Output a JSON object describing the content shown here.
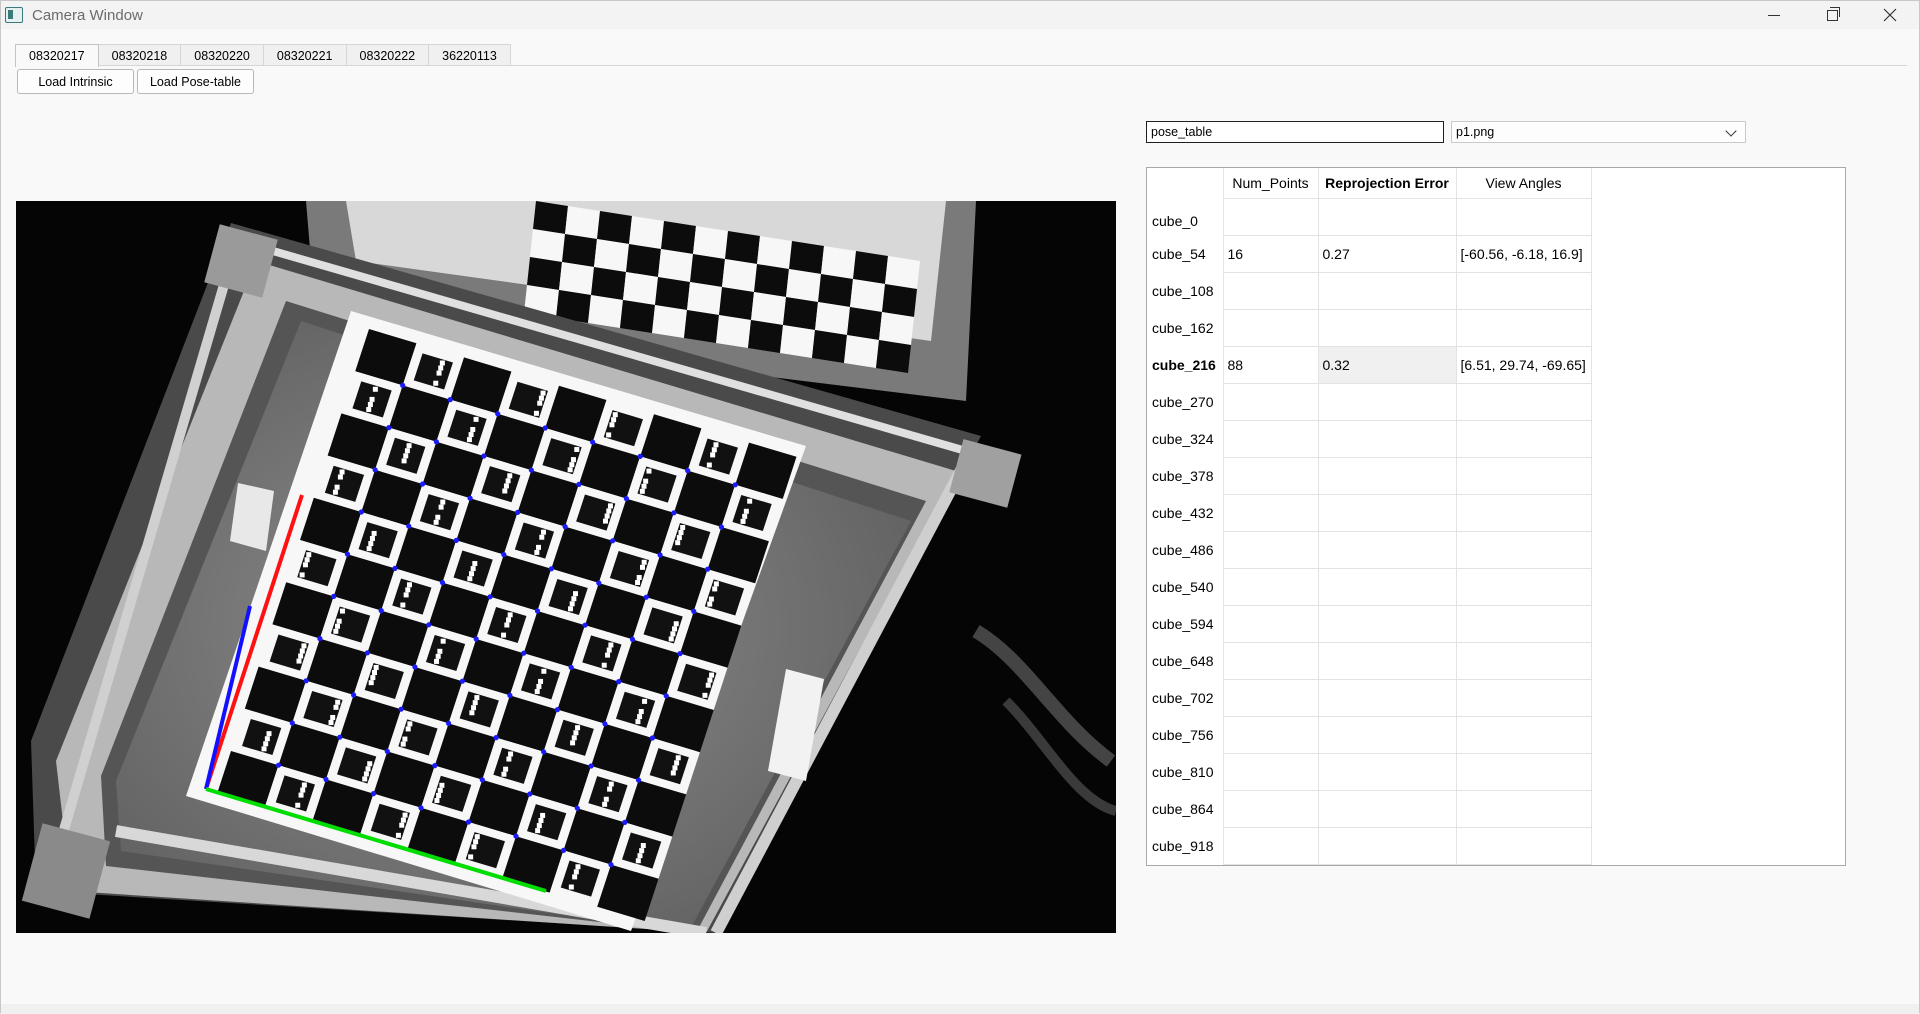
{
  "window": {
    "title": "Camera Window"
  },
  "tabs": [
    {
      "label": "08320217",
      "active": true
    },
    {
      "label": "08320218",
      "active": false
    },
    {
      "label": "08320220",
      "active": false
    },
    {
      "label": "08320221",
      "active": false
    },
    {
      "label": "08320222",
      "active": false
    },
    {
      "label": "36220113",
      "active": false
    }
  ],
  "toolbar": {
    "load_intrinsic": "Load Intrinsic",
    "load_pose_table": "Load Pose-table"
  },
  "controls": {
    "pose_input_value": "pose_table",
    "image_select_value": "p1.png"
  },
  "table": {
    "headers": [
      "Num_Points",
      "Reprojection Error",
      "View Angles"
    ],
    "rows": [
      {
        "label": "cube_0",
        "num_points": "",
        "error": "",
        "angles": ""
      },
      {
        "label": "cube_54",
        "num_points": "16",
        "error": "0.27",
        "angles": "[-60.56, -6.18, 16.9]"
      },
      {
        "label": "cube_108",
        "num_points": "",
        "error": "",
        "angles": ""
      },
      {
        "label": "cube_162",
        "num_points": "",
        "error": "",
        "angles": ""
      },
      {
        "label": "cube_216",
        "num_points": "88",
        "error": "0.32",
        "angles": "[6.51, 29.74, -69.65]",
        "selected": true
      },
      {
        "label": "cube_270",
        "num_points": "",
        "error": "",
        "angles": ""
      },
      {
        "label": "cube_324",
        "num_points": "",
        "error": "",
        "angles": ""
      },
      {
        "label": "cube_378",
        "num_points": "",
        "error": "",
        "angles": ""
      },
      {
        "label": "cube_432",
        "num_points": "",
        "error": "",
        "angles": ""
      },
      {
        "label": "cube_486",
        "num_points": "",
        "error": "",
        "angles": ""
      },
      {
        "label": "cube_540",
        "num_points": "",
        "error": "",
        "angles": ""
      },
      {
        "label": "cube_594",
        "num_points": "",
        "error": "",
        "angles": ""
      },
      {
        "label": "cube_648",
        "num_points": "",
        "error": "",
        "angles": ""
      },
      {
        "label": "cube_702",
        "num_points": "",
        "error": "",
        "angles": ""
      },
      {
        "label": "cube_756",
        "num_points": "",
        "error": "",
        "angles": ""
      },
      {
        "label": "cube_810",
        "num_points": "",
        "error": "",
        "angles": ""
      },
      {
        "label": "cube_864",
        "num_points": "",
        "error": "",
        "angles": ""
      },
      {
        "label": "cube_918",
        "num_points": "",
        "error": "",
        "angles": ""
      }
    ]
  },
  "camera_view": {
    "image": "calibration-board-photo",
    "axis_colors": {
      "x": "#00dd00",
      "y": "#ff1111",
      "z": "#1111ff"
    },
    "corner_color": "#1a1aff"
  },
  "icons": {
    "app": "camera-window-icon",
    "minimize": "minimize-icon",
    "maximize": "restore-icon",
    "close": "close-icon",
    "dropdown": "chevron-down-icon"
  }
}
